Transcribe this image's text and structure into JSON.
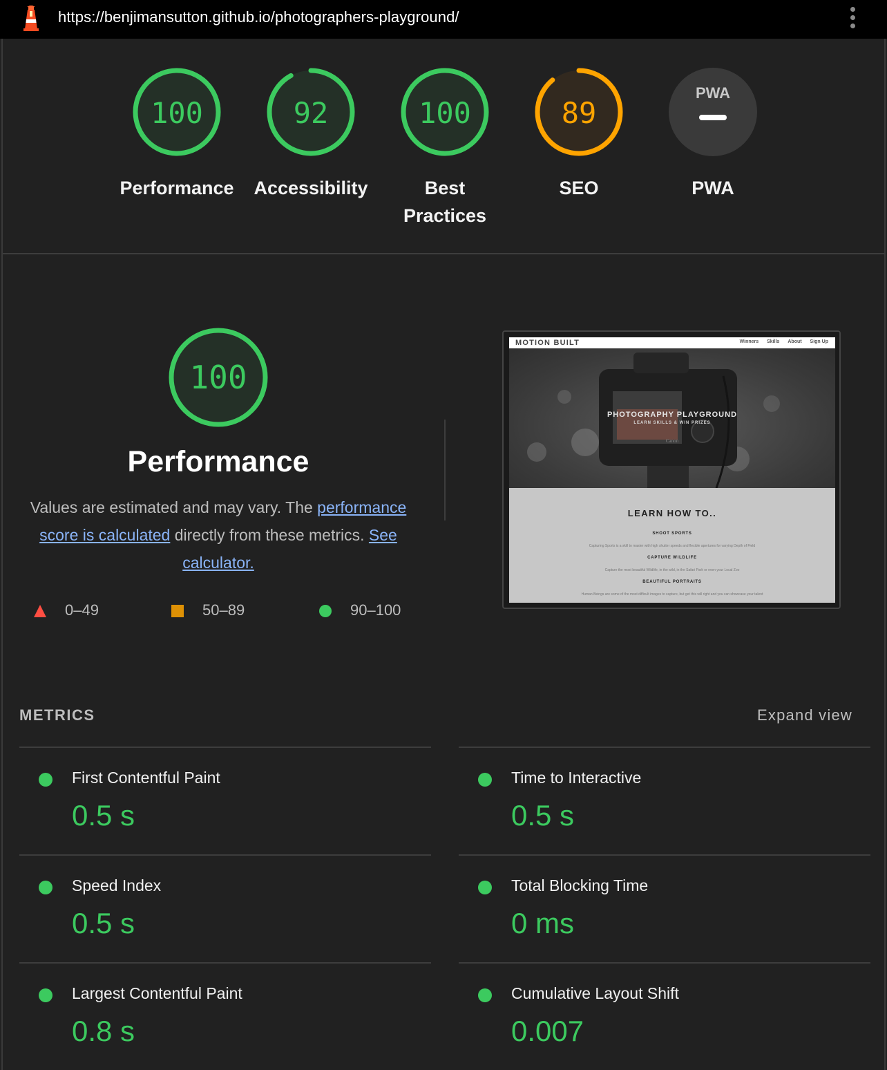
{
  "topbar": {
    "url": "https://benjimansutton.github.io/photographers-playground/"
  },
  "colors": {
    "pass": "#3cca5f",
    "average": "#ffa400",
    "fail": "#ff4e42",
    "background": "#212121"
  },
  "gauges": [
    {
      "score": "100",
      "label": "Performance",
      "value": 100,
      "color": "#3cca5f"
    },
    {
      "score": "92",
      "label": "Accessibility",
      "value": 92,
      "color": "#3cca5f"
    },
    {
      "score": "100",
      "label_line1": "Best",
      "label_line2": "Practices",
      "value": 100,
      "color": "#3cca5f"
    },
    {
      "score": "89",
      "label": "SEO",
      "value": 89,
      "color": "#ffa400"
    },
    {
      "badge": "PWA",
      "label": "PWA"
    }
  ],
  "performance": {
    "score": "100",
    "title": "Performance",
    "desc_prefix": "Values are estimated and may vary. The ",
    "link1": "performance score is calculated",
    "desc_middle": " directly from these metrics. ",
    "link2": "See calculator."
  },
  "legend": [
    {
      "range": "0–49",
      "shape": "triangle",
      "color": "#ff4e42"
    },
    {
      "range": "50–89",
      "shape": "square",
      "color": "#ffa400"
    },
    {
      "range": "90–100",
      "shape": "circle",
      "color": "#3cca5f"
    }
  ],
  "screenshot": {
    "brand": "MOTION BUILT",
    "nav": [
      "Winners",
      "Skills",
      "About",
      "Sign Up"
    ],
    "hero_title": "PHOTOGRAPHY PLAYGROUND",
    "hero_sub": "LEARN SKILLS & WIN PRIZES",
    "camera_brand": "Canon",
    "learn": "LEARN HOW TO..",
    "items": [
      {
        "title": "SHOOT SPORTS",
        "text": "Capturing Sports is a skill to master with high shutter speeds and flexible apertures for varying Depth of Field"
      },
      {
        "title": "CAPTURE WILDLIFE",
        "text": "Capture the most beautiful Wildlife, in the wild, in the Safari Park or even your Local Zoo"
      },
      {
        "title": "BEAUTIFUL PORTRAITS",
        "text": "Human Beings are some of the most difficult images to capture, but get this will right and you can showcase your talent"
      }
    ]
  },
  "metrics": {
    "header": "METRICS",
    "expand": "Expand view",
    "items": [
      {
        "title": "First Contentful Paint",
        "value": "0.5 s"
      },
      {
        "title": "Time to Interactive",
        "value": "0.5 s"
      },
      {
        "title": "Speed Index",
        "value": "0.5 s"
      },
      {
        "title": "Total Blocking Time",
        "value": "0 ms"
      },
      {
        "title": "Largest Contentful Paint",
        "value": "0.8 s"
      },
      {
        "title": "Cumulative Layout Shift",
        "value": "0.007"
      }
    ]
  }
}
